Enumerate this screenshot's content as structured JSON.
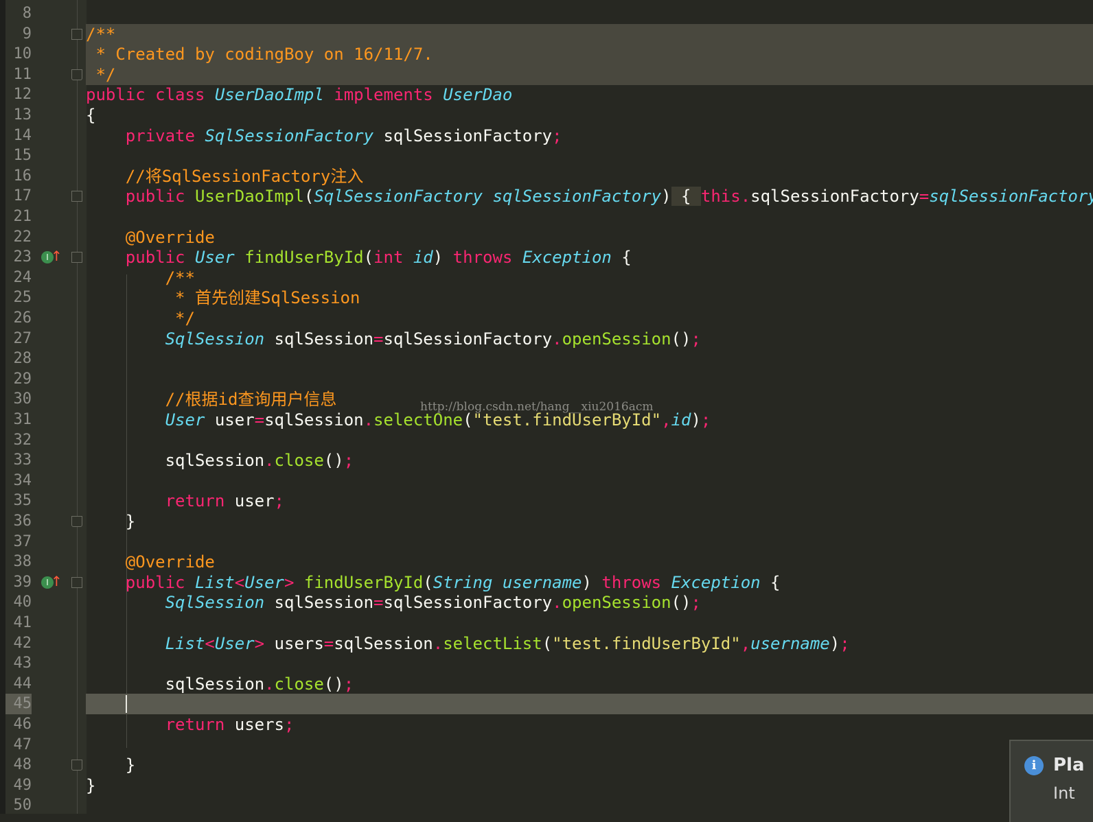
{
  "watermark": "http://blog.csdn.net/hang__xiu2016acm",
  "popup": {
    "icon": "info-icon",
    "title": "Pla",
    "subtitle": "Int"
  },
  "lines": [
    {
      "n": "8",
      "tokens": []
    },
    {
      "n": "9",
      "hl": "doc",
      "fold": "start",
      "tokens": [
        {
          "t": "/**",
          "c": "cm"
        }
      ]
    },
    {
      "n": "10",
      "hl": "doc",
      "tokens": [
        {
          "t": " * Created by codingBoy on 16/11/7.",
          "c": "cm"
        }
      ]
    },
    {
      "n": "11",
      "hl": "doc",
      "fold": "end",
      "tokens": [
        {
          "t": " */",
          "c": "cm"
        }
      ]
    },
    {
      "n": "12",
      "tokens": [
        {
          "t": "public class ",
          "c": "kw"
        },
        {
          "t": "UserDaoImpl",
          "c": "ty"
        },
        {
          "t": " implements ",
          "c": "kw"
        },
        {
          "t": "UserDao",
          "c": "ty"
        }
      ]
    },
    {
      "n": "13",
      "tokens": [
        {
          "t": "{",
          "c": "pl"
        }
      ]
    },
    {
      "n": "14",
      "tokens": [
        {
          "t": "    private ",
          "c": "kw"
        },
        {
          "t": "SqlSessionFactory",
          "c": "ty"
        },
        {
          "t": " sqlSessionFactory",
          "c": "pl"
        },
        {
          "t": ";",
          "c": "op"
        }
      ]
    },
    {
      "n": "15",
      "tokens": []
    },
    {
      "n": "16",
      "tokens": [
        {
          "t": "    //将SqlSessionFactory注入",
          "c": "cm"
        }
      ]
    },
    {
      "n": "17",
      "fold": "collapsed",
      "tokens": [
        {
          "t": "    public ",
          "c": "kw"
        },
        {
          "t": "UserDaoImpl",
          "c": "fn"
        },
        {
          "t": "(",
          "c": "pl"
        },
        {
          "t": "SqlSessionFactory",
          "c": "ty"
        },
        {
          "t": " sqlSessionFactory",
          "c": "pa"
        },
        {
          "t": ")",
          "c": "pl"
        },
        {
          "t": " { ",
          "c": "br-hl"
        },
        {
          "t": "this",
          "c": "kw"
        },
        {
          "t": ".",
          "c": "op"
        },
        {
          "t": "sqlSessionFactory",
          "c": "pl"
        },
        {
          "t": "=",
          "c": "op"
        },
        {
          "t": "sqlSessionFactory",
          "c": "pa"
        },
        {
          "t": ";",
          "c": "op"
        },
        {
          "t": " }",
          "c": "br-hl"
        }
      ]
    },
    {
      "n": "21",
      "tokens": []
    },
    {
      "n": "22",
      "tokens": [
        {
          "t": "    @Override",
          "c": "an"
        }
      ]
    },
    {
      "n": "23",
      "impl": true,
      "fold": "start",
      "tokens": [
        {
          "t": "    public ",
          "c": "kw"
        },
        {
          "t": "User",
          "c": "ty"
        },
        {
          "t": " findUserById",
          "c": "fn"
        },
        {
          "t": "(",
          "c": "pl"
        },
        {
          "t": "int",
          "c": "kw"
        },
        {
          "t": " id",
          "c": "pa"
        },
        {
          "t": ")",
          "c": "pl"
        },
        {
          "t": " throws ",
          "c": "kw"
        },
        {
          "t": "Exception",
          "c": "ty"
        },
        {
          "t": " {",
          "c": "pl"
        }
      ]
    },
    {
      "n": "24",
      "tokens": [
        {
          "t": "        /**",
          "c": "cm"
        }
      ]
    },
    {
      "n": "25",
      "tokens": [
        {
          "t": "         * 首先创建SqlSession",
          "c": "cm"
        }
      ]
    },
    {
      "n": "26",
      "tokens": [
        {
          "t": "         */",
          "c": "cm"
        }
      ]
    },
    {
      "n": "27",
      "tokens": [
        {
          "t": "        SqlSession",
          "c": "ty"
        },
        {
          "t": " sqlSession",
          "c": "pl"
        },
        {
          "t": "=",
          "c": "op"
        },
        {
          "t": "sqlSessionFactory",
          "c": "pl"
        },
        {
          "t": ".",
          "c": "op"
        },
        {
          "t": "openSession",
          "c": "fn"
        },
        {
          "t": "()",
          "c": "pl"
        },
        {
          "t": ";",
          "c": "op"
        }
      ]
    },
    {
      "n": "28",
      "tokens": []
    },
    {
      "n": "29",
      "tokens": []
    },
    {
      "n": "30",
      "tokens": [
        {
          "t": "        //根据id查询用户信息",
          "c": "cm"
        }
      ]
    },
    {
      "n": "31",
      "tokens": [
        {
          "t": "        User",
          "c": "ty"
        },
        {
          "t": " user",
          "c": "pl"
        },
        {
          "t": "=",
          "c": "op"
        },
        {
          "t": "sqlSession",
          "c": "pl"
        },
        {
          "t": ".",
          "c": "op"
        },
        {
          "t": "selectOne",
          "c": "fn"
        },
        {
          "t": "(",
          "c": "pl"
        },
        {
          "t": "\"test.findUserById\"",
          "c": "st"
        },
        {
          "t": ",",
          "c": "op"
        },
        {
          "t": "id",
          "c": "pa"
        },
        {
          "t": ")",
          "c": "pl"
        },
        {
          "t": ";",
          "c": "op"
        }
      ]
    },
    {
      "n": "32",
      "tokens": []
    },
    {
      "n": "33",
      "tokens": [
        {
          "t": "        sqlSession",
          "c": "pl"
        },
        {
          "t": ".",
          "c": "op"
        },
        {
          "t": "close",
          "c": "fn"
        },
        {
          "t": "()",
          "c": "pl"
        },
        {
          "t": ";",
          "c": "op"
        }
      ]
    },
    {
      "n": "34",
      "tokens": []
    },
    {
      "n": "35",
      "tokens": [
        {
          "t": "        return",
          "c": "kw"
        },
        {
          "t": " user",
          "c": "pl"
        },
        {
          "t": ";",
          "c": "op"
        }
      ]
    },
    {
      "n": "36",
      "fold": "end",
      "tokens": [
        {
          "t": "    }",
          "c": "pl"
        }
      ]
    },
    {
      "n": "37",
      "tokens": []
    },
    {
      "n": "38",
      "tokens": [
        {
          "t": "    @Override",
          "c": "an"
        }
      ]
    },
    {
      "n": "39",
      "impl": true,
      "fold": "start",
      "tokens": [
        {
          "t": "    public ",
          "c": "kw"
        },
        {
          "t": "List",
          "c": "ty"
        },
        {
          "t": "<",
          "c": "op"
        },
        {
          "t": "User",
          "c": "ty"
        },
        {
          "t": ">",
          "c": "op"
        },
        {
          "t": " findUserById",
          "c": "fn"
        },
        {
          "t": "(",
          "c": "pl"
        },
        {
          "t": "String",
          "c": "ty"
        },
        {
          "t": " username",
          "c": "pa"
        },
        {
          "t": ")",
          "c": "pl"
        },
        {
          "t": " throws ",
          "c": "kw"
        },
        {
          "t": "Exception",
          "c": "ty"
        },
        {
          "t": " {",
          "c": "pl"
        }
      ]
    },
    {
      "n": "40",
      "tokens": [
        {
          "t": "        SqlSession",
          "c": "ty"
        },
        {
          "t": " sqlSession",
          "c": "pl"
        },
        {
          "t": "=",
          "c": "op"
        },
        {
          "t": "sqlSessionFactory",
          "c": "pl"
        },
        {
          "t": ".",
          "c": "op"
        },
        {
          "t": "openSession",
          "c": "fn"
        },
        {
          "t": "()",
          "c": "pl"
        },
        {
          "t": ";",
          "c": "op"
        }
      ]
    },
    {
      "n": "41",
      "tokens": []
    },
    {
      "n": "42",
      "tokens": [
        {
          "t": "        List",
          "c": "ty"
        },
        {
          "t": "<",
          "c": "op"
        },
        {
          "t": "User",
          "c": "ty"
        },
        {
          "t": ">",
          "c": "op"
        },
        {
          "t": " users",
          "c": "pl"
        },
        {
          "t": "=",
          "c": "op"
        },
        {
          "t": "sqlSession",
          "c": "pl"
        },
        {
          "t": ".",
          "c": "op"
        },
        {
          "t": "selectList",
          "c": "fn"
        },
        {
          "t": "(",
          "c": "pl"
        },
        {
          "t": "\"test.findUserById\"",
          "c": "st"
        },
        {
          "t": ",",
          "c": "op"
        },
        {
          "t": "username",
          "c": "pa"
        },
        {
          "t": ")",
          "c": "pl"
        },
        {
          "t": ";",
          "c": "op"
        }
      ]
    },
    {
      "n": "43",
      "tokens": []
    },
    {
      "n": "44",
      "tokens": [
        {
          "t": "        sqlSession",
          "c": "pl"
        },
        {
          "t": ".",
          "c": "op"
        },
        {
          "t": "close",
          "c": "fn"
        },
        {
          "t": "()",
          "c": "pl"
        },
        {
          "t": ";",
          "c": "op"
        }
      ]
    },
    {
      "n": "45",
      "hl": "caret",
      "tokens": []
    },
    {
      "n": "46",
      "tokens": [
        {
          "t": "        return",
          "c": "kw"
        },
        {
          "t": " users",
          "c": "pl"
        },
        {
          "t": ";",
          "c": "op"
        }
      ]
    },
    {
      "n": "47",
      "tokens": []
    },
    {
      "n": "48",
      "fold": "end",
      "tokens": [
        {
          "t": "    }",
          "c": "pl"
        }
      ]
    },
    {
      "n": "49",
      "tokens": [
        {
          "t": "}",
          "c": "pl"
        }
      ]
    },
    {
      "n": "50",
      "tokens": []
    }
  ]
}
